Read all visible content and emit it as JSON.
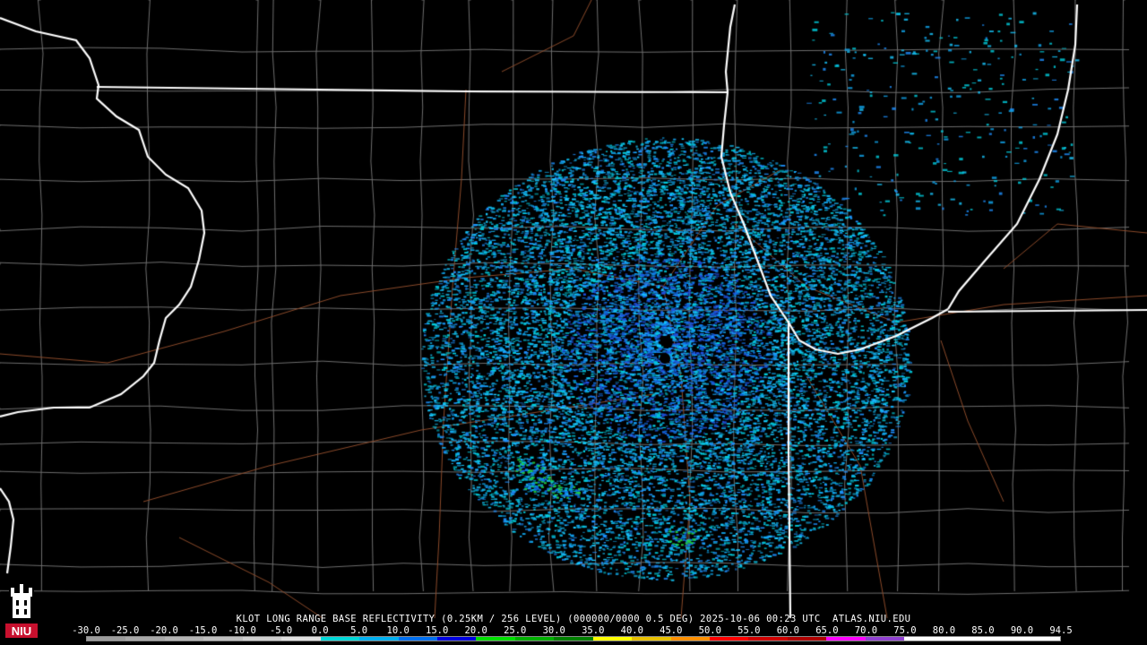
{
  "caption": "KLOT LONG RANGE BASE REFLECTIVITY (0.25KM / 256 LEVEL) (000000/0000 0.5 DEG) 2025-10-06 00:23 UTC  ATLAS.NIU.EDU",
  "scale_ticks": [
    "-30.0",
    "-25.0",
    "-20.0",
    "-15.0",
    "-10.0",
    "-5.0",
    "0.0",
    "5.0",
    "10.0",
    "15.0",
    "20.0",
    "25.0",
    "30.0",
    "35.0",
    "40.0",
    "45.0",
    "50.0",
    "55.0",
    "60.0",
    "65.0",
    "70.0",
    "75.0",
    "80.0",
    "85.0",
    "90.0",
    "94.5"
  ],
  "scale_colors": [
    "#9c9c9c",
    "#a8a8a8",
    "#b4b4b4",
    "#c0c0c0",
    "#d0d0d0",
    "#e0e0e0",
    "#00d8d8",
    "#00b0f0",
    "#0070f0",
    "#0000e0",
    "#00e000",
    "#00b000",
    "#008000",
    "#ffff00",
    "#e8c000",
    "#ff9000",
    "#ff0000",
    "#d00000",
    "#b00000",
    "#ff00ff",
    "#9040d0",
    "#ffffff",
    "#ffffff",
    "#ffffff",
    "#ffffff"
  ],
  "logo": {
    "text": "NIU",
    "color": "#c8102e"
  },
  "palette": {
    "background": "#000000",
    "state_lines": "#ffffff",
    "county_lines": "#6e6e6e",
    "roads": "#8b4a2a"
  }
}
